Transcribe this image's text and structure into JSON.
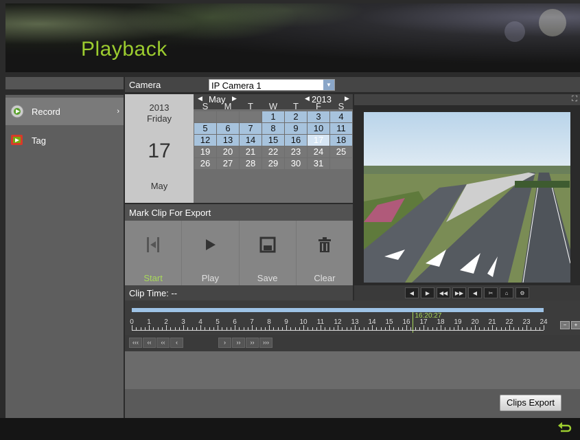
{
  "header": {
    "title": "Playback"
  },
  "sidebar": {
    "items": [
      {
        "label": "Record",
        "icon": "record-icon",
        "arrow": "›",
        "active": true
      },
      {
        "label": "Tag",
        "icon": "tag-icon",
        "active": false
      }
    ]
  },
  "camera": {
    "label": "Camera",
    "selected": "IP Camera 1"
  },
  "date_panel": {
    "year": "2013",
    "weekday": "Friday",
    "day": "17",
    "month": "May"
  },
  "calendar": {
    "month": "May",
    "year": "2013",
    "weekdays": [
      "S",
      "M",
      "T",
      "W",
      "T",
      "F",
      "S"
    ],
    "cells": [
      "",
      "",
      "",
      "1",
      "2",
      "3",
      "4",
      "5",
      "6",
      "7",
      "8",
      "9",
      "10",
      "11",
      "12",
      "13",
      "14",
      "15",
      "16",
      "17",
      "18",
      "19",
      "20",
      "21",
      "22",
      "23",
      "24",
      "25",
      "26",
      "27",
      "28",
      "29",
      "30",
      "31",
      ""
    ],
    "recorded_days": [
      "1",
      "2",
      "3",
      "4",
      "5",
      "6",
      "7",
      "8",
      "9",
      "10",
      "11",
      "12",
      "13",
      "14",
      "15",
      "16",
      "18"
    ],
    "selected_day": "17",
    "colors": {
      "recorded": "#a7c3dd",
      "selected": "#d7e6f4"
    }
  },
  "mark_clip": {
    "title": "Mark Clip For Export",
    "buttons": [
      {
        "label": "Start",
        "icon": "start-bracket-icon"
      },
      {
        "label": "Play",
        "icon": "play-icon"
      },
      {
        "label": "Save",
        "icon": "save-icon"
      },
      {
        "label": "Clear",
        "icon": "trash-icon"
      }
    ],
    "clip_time": "Clip Time: --"
  },
  "timeline": {
    "current_time": "16:20:27",
    "hours": [
      "0",
      "1",
      "2",
      "3",
      "4",
      "5",
      "6",
      "7",
      "8",
      "9",
      "10",
      "11",
      "12",
      "13",
      "14",
      "15",
      "16",
      "17",
      "18",
      "19",
      "20",
      "21",
      "22",
      "23",
      "24"
    ],
    "cursor_hour": 16.34
  },
  "nav_buttons": [
    "‹‹‹",
    "‹‹",
    "‹‹",
    "‹",
    "›",
    "››",
    "››",
    "›››"
  ],
  "footer": {
    "export_label": "Clips Export"
  },
  "accent_colors": {
    "title": "#9ccc2f",
    "timeline": "#9ec3e6",
    "cursor": "#a8d95a"
  }
}
